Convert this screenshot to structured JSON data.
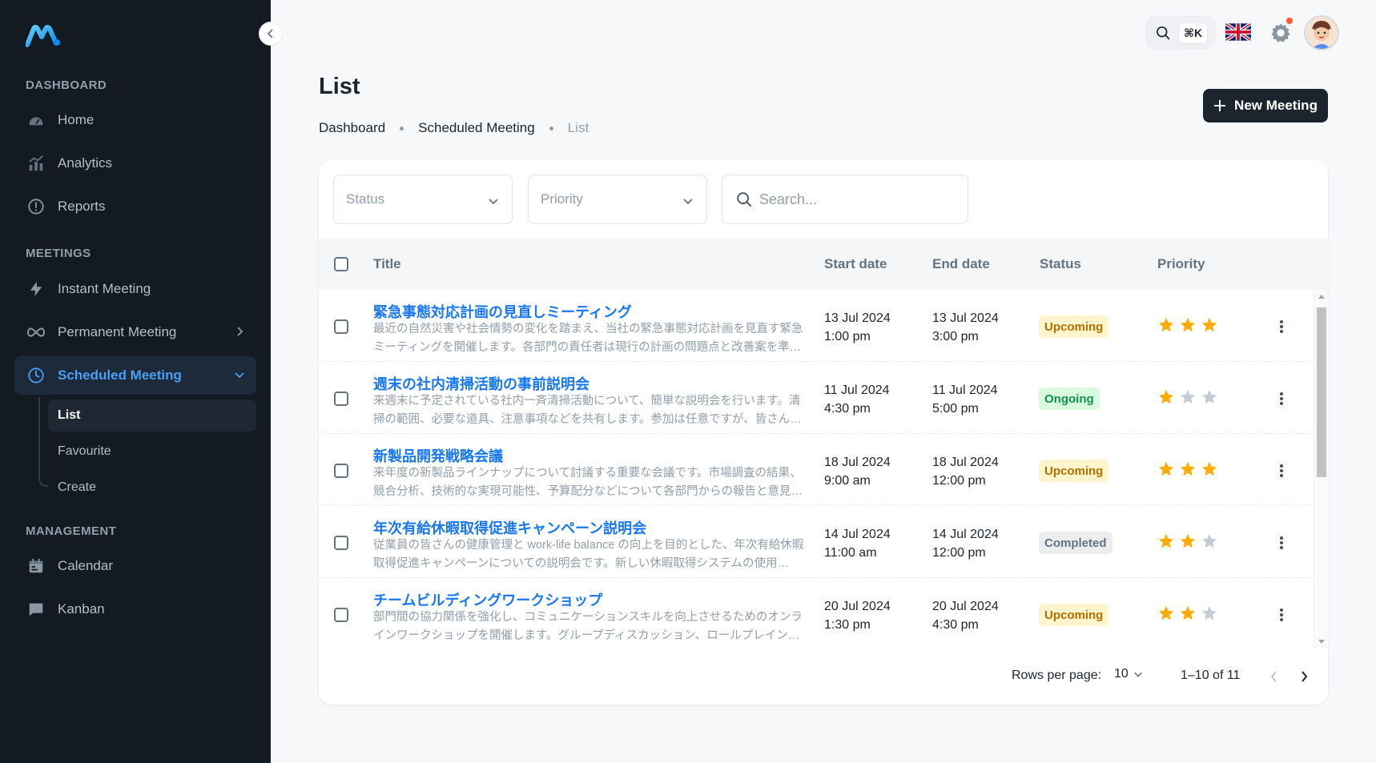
{
  "sidebar": {
    "logo": "minimal-logo",
    "sections": {
      "dashboard": "DASHBOARD",
      "meetings": "MEETINGS",
      "management": "MANAGEMENT"
    },
    "items": {
      "home": "Home",
      "analytics": "Analytics",
      "reports": "Reports",
      "instant": "Instant Meeting",
      "permanent": "Permanent Meeting",
      "scheduled": "Scheduled Meeting",
      "list": "List",
      "favourite": "Favourite",
      "create": "Create",
      "calendar": "Calendar",
      "kanban": "Kanban"
    }
  },
  "topbar": {
    "shortcut": "⌘K",
    "language": "English (UK)"
  },
  "page": {
    "title": "List",
    "breadcrumb": [
      "Dashboard",
      "Scheduled Meeting",
      "List"
    ],
    "new_button": "New Meeting"
  },
  "filters": {
    "status_placeholder": "Status",
    "priority_placeholder": "Priority",
    "search_placeholder": "Search..."
  },
  "table": {
    "headers": {
      "title": "Title",
      "start": "Start date",
      "end": "End date",
      "status": "Status",
      "priority": "Priority"
    },
    "rows": [
      {
        "title": "緊急事態対応計画の見直しミーティング",
        "description": "最近の自然災害や社会情勢の変化を踏まえ、当社の緊急事態対応計画を見直す緊急ミーティングを開催します。各部門の責任者は現行の計画の問題点と改善案を準…",
        "start_date": "13 Jul 2024",
        "start_time": "1:00 pm",
        "end_date": "13 Jul 2024",
        "end_time": "3:00 pm",
        "status": "Upcoming",
        "status_type": "upcoming",
        "priority": 3
      },
      {
        "title": "週末の社内清掃活動の事前説明会",
        "description": "来週末に予定されている社内一斉清掃活動について、簡単な説明会を行います。清掃の範囲、必要な道具、注意事項などを共有します。参加は任意ですが、皆さん…",
        "start_date": "11 Jul 2024",
        "start_time": "4:30 pm",
        "end_date": "11 Jul 2024",
        "end_time": "5:00 pm",
        "status": "Ongoing",
        "status_type": "ongoing",
        "priority": 1
      },
      {
        "title": "新製品開発戦略会議",
        "description": "来年度の新製品ラインナップについて討議する重要な会議です。市場調査の結果、競合分析、技術的な実現可能性、予算配分などについて各部門からの報告と意見…",
        "start_date": "18 Jul 2024",
        "start_time": "9:00 am",
        "end_date": "18 Jul 2024",
        "end_time": "12:00 pm",
        "status": "Upcoming",
        "status_type": "upcoming",
        "priority": 3
      },
      {
        "title": "年次有給休暇取得促進キャンペーン説明会",
        "description": "従業員の皆さんの健康管理と work-life balance の向上を目的とした、年次有給休暇取得促進キャンペーンについての説明会です。新しい休暇取得システムの使用…",
        "start_date": "14 Jul 2024",
        "start_time": "11:00 am",
        "end_date": "14 Jul 2024",
        "end_time": "12:00 pm",
        "status": "Completed",
        "status_type": "completed",
        "priority": 2
      },
      {
        "title": "チームビルディングワークショップ",
        "description": "部門間の協力関係を強化し、コミュニケーションスキルを向上させるためのオンラインワークショップを開催します。グループディスカッション、ロールプレイン…",
        "start_date": "20 Jul 2024",
        "start_time": "1:30 pm",
        "end_date": "20 Jul 2024",
        "end_time": "4:30 pm",
        "status": "Upcoming",
        "status_type": "upcoming",
        "priority": 2
      }
    ]
  },
  "pagination": {
    "rows_label": "Rows per page:",
    "rows_value": "10",
    "range": "1–10 of 11"
  },
  "colors": {
    "accent": "#1877f2",
    "star_on": "#ffab00",
    "star_off": "#c4cdd5"
  }
}
